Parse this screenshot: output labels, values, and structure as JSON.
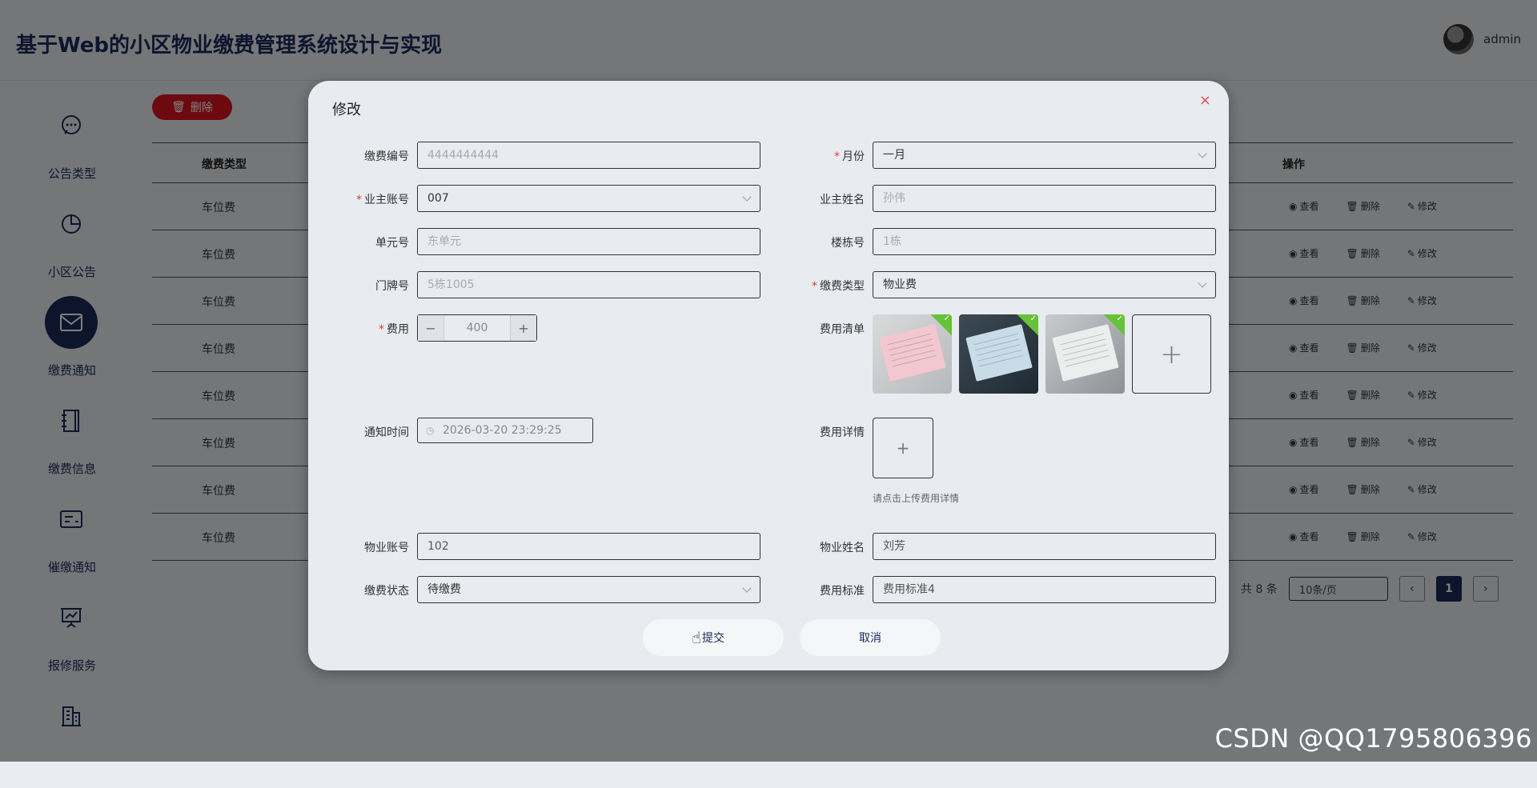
{
  "header": {
    "title": "基于Web的小区物业缴费管理系统设计与实现",
    "username": "admin"
  },
  "sidebar": {
    "items": [
      {
        "label": "公告类型",
        "icon": "chat-icon"
      },
      {
        "label": "小区公告",
        "icon": "pie-chart-icon"
      },
      {
        "label": "缴费通知",
        "icon": "mail-icon",
        "active": true
      },
      {
        "label": "缴费信息",
        "icon": "notebook-icon"
      },
      {
        "label": "催缴通知",
        "icon": "card-icon"
      },
      {
        "label": "报修服务",
        "icon": "presentation-icon"
      },
      {
        "label": "",
        "icon": "building-icon"
      }
    ]
  },
  "toolbar": {
    "delete_label": "删除"
  },
  "table": {
    "headers": {
      "type": "缴费类型",
      "ops": "操作"
    },
    "rows": [
      "车位费",
      "车位费",
      "车位费",
      "车位费",
      "车位费",
      "车位费",
      "车位费",
      "车位费"
    ],
    "op_view": "查看",
    "op_delete": "删除",
    "op_edit": "修改"
  },
  "pager": {
    "total": "共 8 条",
    "size": "10条/页",
    "prev": "‹",
    "next": "›",
    "current": "1"
  },
  "watermark": "CSDN @QQ1795806396",
  "dialog": {
    "title": "修改",
    "close": "×",
    "fields": {
      "fee_no": {
        "label": "缴费编号",
        "value": "4444444444"
      },
      "month": {
        "label": "月份",
        "value": "一月"
      },
      "owner_account": {
        "label": "业主账号",
        "value": "007"
      },
      "owner_name": {
        "label": "业主姓名",
        "value": "孙伟"
      },
      "unit_no": {
        "label": "单元号",
        "value": "东单元"
      },
      "building_no": {
        "label": "楼栋号",
        "value": "1栋"
      },
      "door_no": {
        "label": "门牌号",
        "value": "5栋1005"
      },
      "fee_type": {
        "label": "缴费类型",
        "value": "物业费"
      },
      "fee": {
        "label": "费用",
        "value": "400",
        "minus": "−",
        "plus": "+"
      },
      "fee_list": {
        "label": "费用清单",
        "add": "+"
      },
      "notify_time": {
        "label": "通知时间",
        "value": "2026-03-20 23:29:25"
      },
      "fee_detail": {
        "label": "费用详情",
        "add": "+",
        "hint": "请点击上传费用详情"
      },
      "property_account": {
        "label": "物业账号",
        "value": "102"
      },
      "property_name": {
        "label": "物业姓名",
        "value": "刘芳"
      },
      "pay_status": {
        "label": "缴费状态",
        "value": "待缴费"
      },
      "fee_standard": {
        "label": "费用标准",
        "value": "费用标准4"
      }
    },
    "submit": "提交",
    "cancel": "取消"
  },
  "colors": {
    "accent": "#1b2a5a",
    "danger": "#d9141e",
    "success": "#67c23a"
  }
}
